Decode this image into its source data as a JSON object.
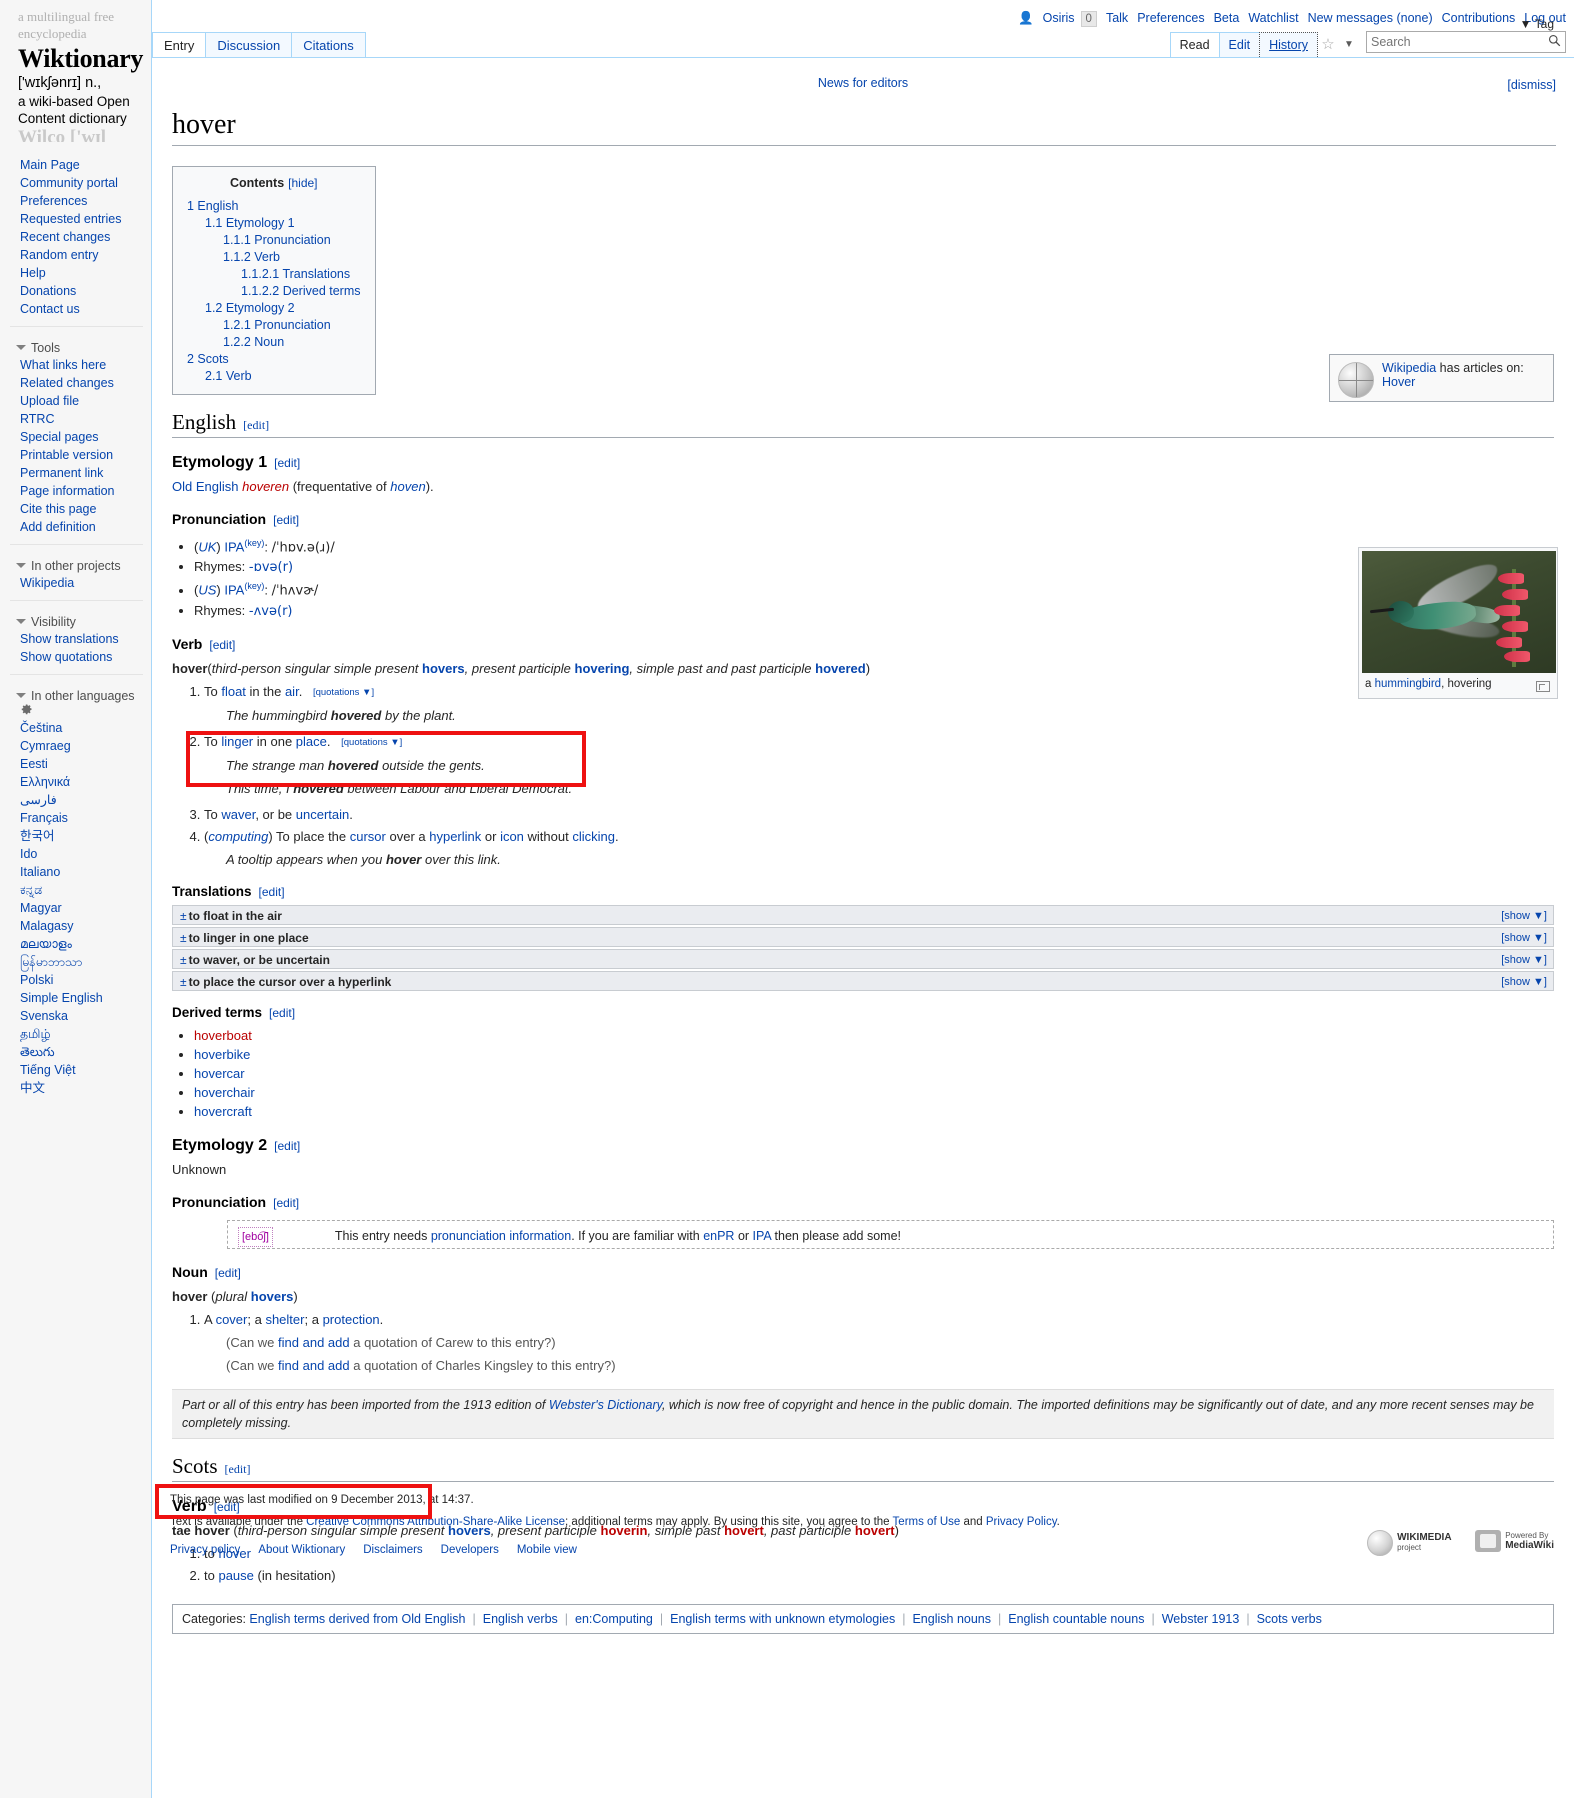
{
  "site": {
    "tagline_top": "a multilingual free encyclopedia",
    "logo_word": "Wiktionary",
    "logo_ipa": "['wɪkʃənrɪ] n.,",
    "logo_sub1": "a wiki-based Open",
    "logo_sub2": "Content dictionary",
    "logo_fade": "Wilco ['wɪl kəʊ]"
  },
  "personal": {
    "user_icon": "user-icon",
    "username": "Osiris",
    "notification_count": "0",
    "links": [
      "Talk",
      "Preferences",
      "Beta",
      "Watchlist",
      "New messages (none)",
      "Contributions",
      "Log out"
    ]
  },
  "ns_tabs": [
    {
      "label": "Entry",
      "selected": true
    },
    {
      "label": "Discussion",
      "selected": false
    },
    {
      "label": "Citations",
      "selected": false
    }
  ],
  "view_tabs": [
    {
      "label": "Read",
      "selected": true
    },
    {
      "label": "Edit",
      "selected": false
    },
    {
      "label": "History",
      "selected": false
    }
  ],
  "search": {
    "placeholder": "Search",
    "value": "",
    "tag_label": "Tag",
    "magnifier_icon": "search-icon",
    "caret_icon": "chevron-down-icon"
  },
  "sidebar": {
    "navigation": [
      "Main Page",
      "Community portal",
      "Preferences",
      "Requested entries",
      "Recent changes",
      "Random entry",
      "Help",
      "Donations",
      "Contact us"
    ],
    "tools_heading": "Tools",
    "tools": [
      "What links here",
      "Related changes",
      "Upload file",
      "RTRC",
      "Special pages",
      "Printable version",
      "Permanent link",
      "Page information",
      "Cite this page",
      "Add definition"
    ],
    "projects_heading": "In other projects",
    "projects": [
      "Wikipedia"
    ],
    "visibility_heading": "Visibility",
    "visibility": [
      "Show translations",
      "Show quotations"
    ],
    "languages_heading": "In other languages",
    "languages_gear_icon": "gear-icon",
    "languages": [
      "Čeština",
      "Cymraeg",
      "Eesti",
      "Ελληνικά",
      "فارسی",
      "Français",
      "한국어",
      "Ido",
      "Italiano",
      "ಕನ್ನಡ",
      "Magyar",
      "Malagasy",
      "മലയാളം",
      "မြန်မာဘာသာ",
      "Polski",
      "Simple English",
      "Svenska",
      "தமிழ்",
      "తెలుగు",
      "Tiếng Việt",
      "中文"
    ]
  },
  "notice": {
    "news_link": "News for editors",
    "dismiss": "[dismiss]"
  },
  "page": {
    "title": "hover"
  },
  "toc": {
    "title": "Contents",
    "toggle": "[hide]",
    "items": [
      {
        "num": "1",
        "label": "English",
        "level": 1
      },
      {
        "num": "1.1",
        "label": "Etymology 1",
        "level": 2
      },
      {
        "num": "1.1.1",
        "label": "Pronunciation",
        "level": 3
      },
      {
        "num": "1.1.2",
        "label": "Verb",
        "level": 3
      },
      {
        "num": "1.1.2.1",
        "label": "Translations",
        "level": 4
      },
      {
        "num": "1.1.2.2",
        "label": "Derived terms",
        "level": 4
      },
      {
        "num": "1.2",
        "label": "Etymology 2",
        "level": 2
      },
      {
        "num": "1.2.1",
        "label": "Pronunciation",
        "level": 3
      },
      {
        "num": "1.2.2",
        "label": "Noun",
        "level": 3
      },
      {
        "num": "2",
        "label": "Scots",
        "level": 1
      },
      {
        "num": "2.1",
        "label": "Verb",
        "level": 2
      }
    ]
  },
  "edit_label": "[edit]",
  "english": {
    "heading": "English",
    "etymology1": {
      "heading": "Etymology 1",
      "text_old_english": "Old English",
      "text_hoveren": "hoveren",
      "text_mid": " (frequentative of ",
      "text_hoven": "hoven",
      "text_end": ")."
    },
    "pronunciation": {
      "heading": "Pronunciation",
      "items": [
        {
          "region": "UK",
          "label": "IPA",
          "key": "(key)",
          "value": "/ˈhɒv.ə(ɹ)/"
        },
        {
          "rhymes_label": "Rhymes:",
          "rhymes": "-ɒvə(r)"
        },
        {
          "region": "US",
          "label": "IPA",
          "key": "(key)",
          "value": "/ˈhʌvɚ/"
        },
        {
          "rhymes_label": "Rhymes:",
          "rhymes": "-ʌvə(r)"
        }
      ]
    },
    "verb": {
      "heading": "Verb",
      "headword": "hover",
      "infl_open": "(",
      "infl_1": "third-person singular simple present ",
      "infl_1b": "hovers",
      "infl_2": ", present participle ",
      "infl_2b": "hovering",
      "infl_3": ", simple past and past participle ",
      "infl_3b": "hovered",
      "infl_close": ")",
      "quotations_label": "[quotations ▼]",
      "senses": [
        {
          "num": "1",
          "parts": [
            {
              "t": "To ",
              "k": "plain"
            },
            {
              "t": "float",
              "k": "link"
            },
            {
              "t": " in the ",
              "k": "plain"
            },
            {
              "t": "air",
              "k": "link"
            },
            {
              "t": ".",
              "k": "plain"
            }
          ],
          "quotations": true,
          "example": "The hummingbird hovered by the plant.",
          "example_bold": "hovered"
        },
        {
          "num": "2",
          "parts": [
            {
              "t": "To ",
              "k": "plain"
            },
            {
              "t": "linger",
              "k": "link"
            },
            {
              "t": " in one ",
              "k": "plain"
            },
            {
              "t": "place",
              "k": "link"
            },
            {
              "t": ".",
              "k": "plain"
            }
          ],
          "quotations": true,
          "example": "The strange man hovered outside the gents.",
          "example2": "This time, I hovered between Labour and Liberal Democrat."
        },
        {
          "num": "3",
          "parts": [
            {
              "t": "To ",
              "k": "plain"
            },
            {
              "t": "waver",
              "k": "link"
            },
            {
              "t": ", or be ",
              "k": "plain"
            },
            {
              "t": "uncertain",
              "k": "link"
            },
            {
              "t": ".",
              "k": "plain"
            }
          ],
          "quotations": false
        },
        {
          "num": "4",
          "context": "computing",
          "parts": [
            {
              "t": "To place the ",
              "k": "plain"
            },
            {
              "t": "cursor",
              "k": "link"
            },
            {
              "t": " over a ",
              "k": "plain"
            },
            {
              "t": "hyperlink",
              "k": "link"
            },
            {
              "t": " or ",
              "k": "plain"
            },
            {
              "t": "icon",
              "k": "link"
            },
            {
              "t": " without ",
              "k": "plain"
            },
            {
              "t": "clicking",
              "k": "link"
            },
            {
              "t": ".",
              "k": "plain"
            }
          ],
          "quotations": false,
          "example": "A tooltip appears when you hover over this link."
        }
      ]
    },
    "translations": {
      "heading": "Translations",
      "show_label": "[show ▼]",
      "bars": [
        "to float in the air",
        "to linger in one place",
        "to waver, or be uncertain",
        "to place the cursor over a hyperlink"
      ]
    },
    "derived_terms": {
      "heading": "Derived terms",
      "items": [
        {
          "label": "hoverboat",
          "new": true
        },
        {
          "label": "hoverbike",
          "new": false
        },
        {
          "label": "hovercar",
          "new": false
        },
        {
          "label": "hoverchair",
          "new": false
        },
        {
          "label": "hovercraft",
          "new": false
        }
      ]
    },
    "etymology2": {
      "heading": "Etymology 2",
      "text": "Unknown"
    },
    "pronunciation2": {
      "heading": "Pronunciation",
      "ipa_tag": "[ebo͡ʃ]",
      "text_1": "This entry needs ",
      "link_1": "pronunciation information",
      "text_2": ". If you are familiar with ",
      "link_2": "enPR",
      "text_3": " or ",
      "link_3": "IPA",
      "text_4": " then please add some!"
    },
    "noun": {
      "heading": "Noun",
      "headword": "hover",
      "infl": "(plural hovers)",
      "infl_plain": "plural ",
      "infl_link": "hovers",
      "senses": [
        {
          "num": "1",
          "parts": [
            {
              "t": "A ",
              "k": "plain"
            },
            {
              "t": "cover",
              "k": "link"
            },
            {
              "t": "; a ",
              "k": "plain"
            },
            {
              "t": "shelter",
              "k": "link"
            },
            {
              "t": "; a ",
              "k": "plain"
            },
            {
              "t": "protection",
              "k": "link"
            },
            {
              "t": ".",
              "k": "plain"
            }
          ],
          "rfquote1_pre": "(Can we ",
          "rfquote1_link": "find and add",
          "rfquote1_post": " a quotation of Carew to this entry?)",
          "rfquote2_pre": "(Can we ",
          "rfquote2_link": "find and add",
          "rfquote2_post": " a quotation of Charles Kingsley to this entry?)"
        }
      ]
    },
    "webster_notice": {
      "pre": "Part or all of this entry has been imported from the 1913 edition of ",
      "link": "Webster's Dictionary",
      "post": ", which is now free of copyright and hence in the public domain. The imported definitions may be significantly out of date, and any more recent senses may be completely missing."
    }
  },
  "scots": {
    "heading": "Scots",
    "verb": {
      "heading": "Verb",
      "headword": "tae hover",
      "infl_1": "third-person singular simple present ",
      "infl_1b": "hovers",
      "infl_2": ", present participle ",
      "infl_2b": "hoverin",
      "infl_3": ", simple past ",
      "infl_3b": "hovert",
      "infl_4": ", past participle ",
      "infl_4b": "hovert",
      "senses": [
        {
          "num": "1",
          "pre": "to ",
          "link": "hover",
          "post": ""
        },
        {
          "num": "2",
          "pre": "to ",
          "link": "pause",
          "post": " (in hesitation)"
        }
      ]
    }
  },
  "categories": {
    "label": "Categories:",
    "items": [
      "English terms derived from Old English",
      "English verbs",
      "en:Computing",
      "English terms with unknown etymologies",
      "English nouns",
      "English countable nouns",
      "Webster 1913",
      "Scots verbs"
    ]
  },
  "sisterbox": {
    "pre": "Wikipedia",
    "mid": " has articles on:",
    "link": "Hover",
    "globe_icon": "wikipedia-globe-icon"
  },
  "thumb": {
    "caption_pre": "a ",
    "caption_link": "hummingbird",
    "caption_post": ", hovering",
    "expand_icon": "expand-icon"
  },
  "footer": {
    "lastmod": "This page was last modified on 9 December 2013, at 14:37.",
    "copyright_pre": "Text is available under the ",
    "copyright_link": "Creative Commons Attribution-Share-Alike License",
    "copyright_mid": "; additional terms may apply. By using this site, you agree to the ",
    "terms_link": "Terms of Use",
    "copyright_and": " and ",
    "privacy_link": "Privacy Policy",
    "copyright_end": ".",
    "links": [
      "Privacy policy",
      "About Wiktionary",
      "Disclaimers",
      "Developers",
      "Mobile view"
    ],
    "wikimedia_label_small": "WIKIMEDIA",
    "wikimedia_label_sub": "project",
    "mediawiki_label_small": "Powered By",
    "mediawiki_label_sub": "MediaWiki"
  },
  "annotations": {
    "highlight_color": "#ee1111",
    "boxes": [
      "definition-4-computing-sense",
      "last-modified-timestamp"
    ]
  }
}
